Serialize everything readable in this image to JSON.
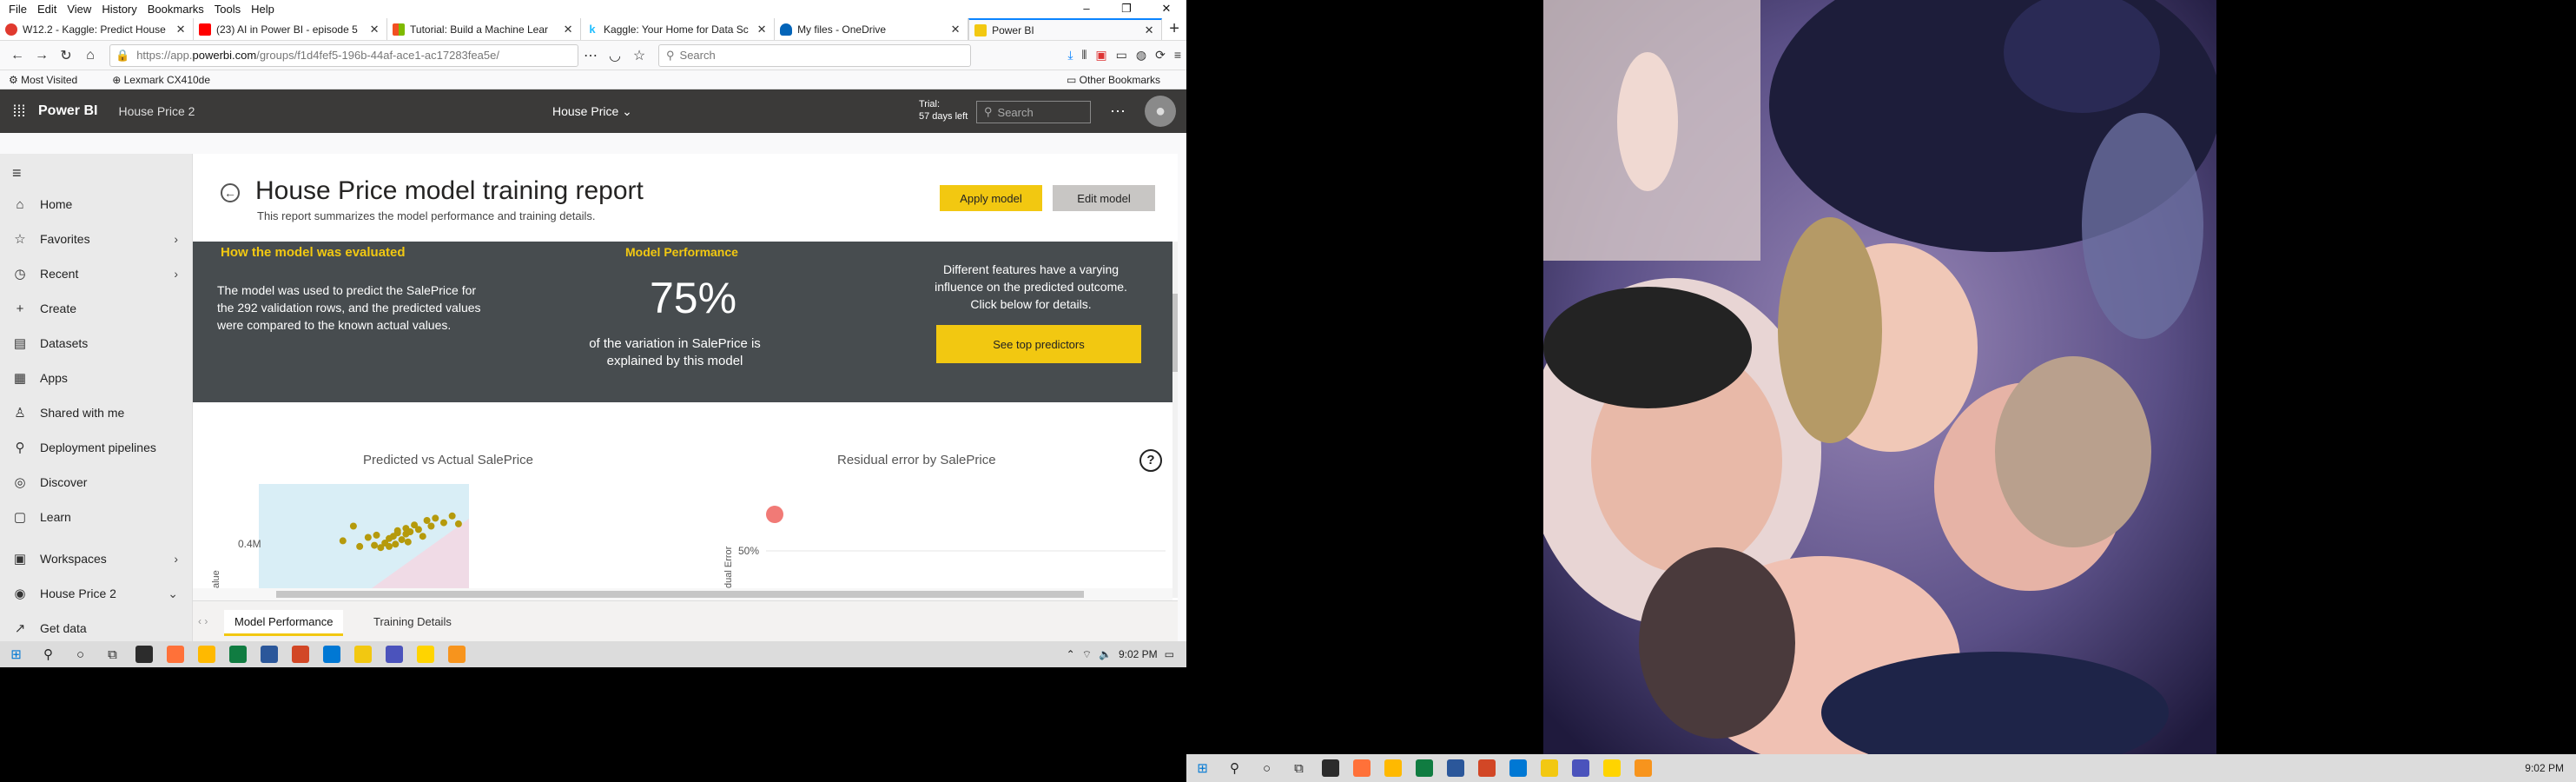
{
  "browser": {
    "menu": [
      "File",
      "Edit",
      "View",
      "History",
      "Bookmarks",
      "Tools",
      "Help"
    ],
    "tabs": [
      {
        "title": "W12.2 - Kaggle: Predict House",
        "color": "#e03a2f"
      },
      {
        "title": "(23) AI in Power BI - episode 5",
        "color": "#ff0000"
      },
      {
        "title": "Tutorial: Build a Machine Lear",
        "color": "#f25022"
      },
      {
        "title": "Kaggle: Your Home for Data Sc",
        "color": "#20beff"
      },
      {
        "title": "My files - OneDrive",
        "color": "#0364b8"
      },
      {
        "title": "Power BI",
        "color": "#f2c811"
      }
    ],
    "url_prefix": "https://app.",
    "url_domain": "powerbi.com",
    "url_rest": "/groups/f1d4fef5-196b-44af-ace1-ac17283fea5e/",
    "search_placeholder": "Search",
    "bookmarks": [
      "Most Visited",
      "Lexmark CX410de"
    ],
    "other_bookmarks": "Other Bookmarks"
  },
  "pbi": {
    "app_name": "Power BI",
    "workspace": "House Price 2",
    "report_dropdown": "House Price",
    "trial_line1": "Trial:",
    "trial_line2": "57 days left",
    "search_placeholder": "Search",
    "sidebar": [
      {
        "label": "Home",
        "icon": "⌂",
        "chev": false
      },
      {
        "label": "Favorites",
        "icon": "☆",
        "chev": true
      },
      {
        "label": "Recent",
        "icon": "◷",
        "chev": true
      },
      {
        "label": "Create",
        "icon": "+",
        "chev": false
      },
      {
        "label": "Datasets",
        "icon": "▤",
        "chev": false
      },
      {
        "label": "Apps",
        "icon": "▦",
        "chev": false
      },
      {
        "label": "Shared with me",
        "icon": "♙",
        "chev": false
      },
      {
        "label": "Deployment pipelines",
        "icon": "⚲",
        "chev": false
      },
      {
        "label": "Discover",
        "icon": "◎",
        "chev": false
      },
      {
        "label": "Learn",
        "icon": "▢",
        "chev": false
      },
      {
        "label": "Workspaces",
        "icon": "▣",
        "chev": true
      },
      {
        "label": "House Price 2",
        "icon": "◉",
        "chev": true
      },
      {
        "label": "Get data",
        "icon": "↗",
        "chev": false
      }
    ],
    "report": {
      "title": "House Price model training report",
      "subtitle": "This report summarizes the model performance and training details.",
      "apply_label": "Apply model",
      "edit_label": "Edit model",
      "eval_title": "How the model was evaluated",
      "eval_body": "The model was used to predict the SalePrice for the 292 validation rows, and the predicted values were compared to the known actual values.",
      "perf_title": "Model Performance",
      "perf_value": "75%",
      "perf_body": "of the variation in SalePrice is explained by this model",
      "features_text": "Different features have a varying influence on the predicted outcome. Click below for details.",
      "top_predictors_label": "See top predictors",
      "chart1_title": "Predicted vs Actual SalePrice",
      "chart2_title": "Residual error by SalePrice",
      "help_label": "?",
      "page_tabs": [
        "Model Performance",
        "Training Details"
      ]
    }
  },
  "chart_data": [
    {
      "type": "scatter",
      "title": "Predicted vs Actual SalePrice",
      "ylabel": "alue",
      "ytick_label": "0.4M",
      "points": [
        {
          "x": 0.52,
          "y": 0.45
        },
        {
          "x": 0.56,
          "y": 0.47
        },
        {
          "x": 0.58,
          "y": 0.36
        },
        {
          "x": 0.6,
          "y": 0.4
        },
        {
          "x": 0.62,
          "y": 0.44
        },
        {
          "x": 0.64,
          "y": 0.46
        },
        {
          "x": 0.66,
          "y": 0.49
        },
        {
          "x": 0.68,
          "y": 0.43
        },
        {
          "x": 0.7,
          "y": 0.48
        },
        {
          "x": 0.66,
          "y": 0.51
        },
        {
          "x": 0.7,
          "y": 0.53
        },
        {
          "x": 0.72,
          "y": 0.5
        },
        {
          "x": 0.74,
          "y": 0.56
        },
        {
          "x": 0.76,
          "y": 0.52
        },
        {
          "x": 0.78,
          "y": 0.46
        },
        {
          "x": 0.8,
          "y": 0.6
        },
        {
          "x": 0.82,
          "y": 0.55
        },
        {
          "x": 0.84,
          "y": 0.62
        },
        {
          "x": 0.88,
          "y": 0.58
        },
        {
          "x": 0.92,
          "y": 0.64
        },
        {
          "x": 0.95,
          "y": 0.57
        },
        {
          "x": 0.45,
          "y": 0.55
        },
        {
          "x": 0.4,
          "y": 0.42
        },
        {
          "x": 0.48,
          "y": 0.37
        },
        {
          "x": 0.55,
          "y": 0.38
        },
        {
          "x": 0.62,
          "y": 0.37
        },
        {
          "x": 0.65,
          "y": 0.39
        },
        {
          "x": 0.71,
          "y": 0.41
        }
      ],
      "point_color": "#b59a0c"
    },
    {
      "type": "scatter",
      "title": "Residual error by SalePrice",
      "ylabel": "dual Error",
      "ytick_label": "50%",
      "points": [
        {
          "x": 0.1,
          "y": 0.85
        }
      ],
      "point_color": "#f17a76"
    }
  ],
  "taskbar": {
    "time": "9:02 PM",
    "apps": [
      "#2c2c2c",
      "#ff7139",
      "#ffb900",
      "#107c41",
      "#2b579a",
      "#d24726",
      "#0078d4",
      "#f2c811",
      "#4b53bc",
      "#ffd400",
      "#f7941d"
    ]
  },
  "photo": {
    "subject": "four people lying on grass"
  }
}
